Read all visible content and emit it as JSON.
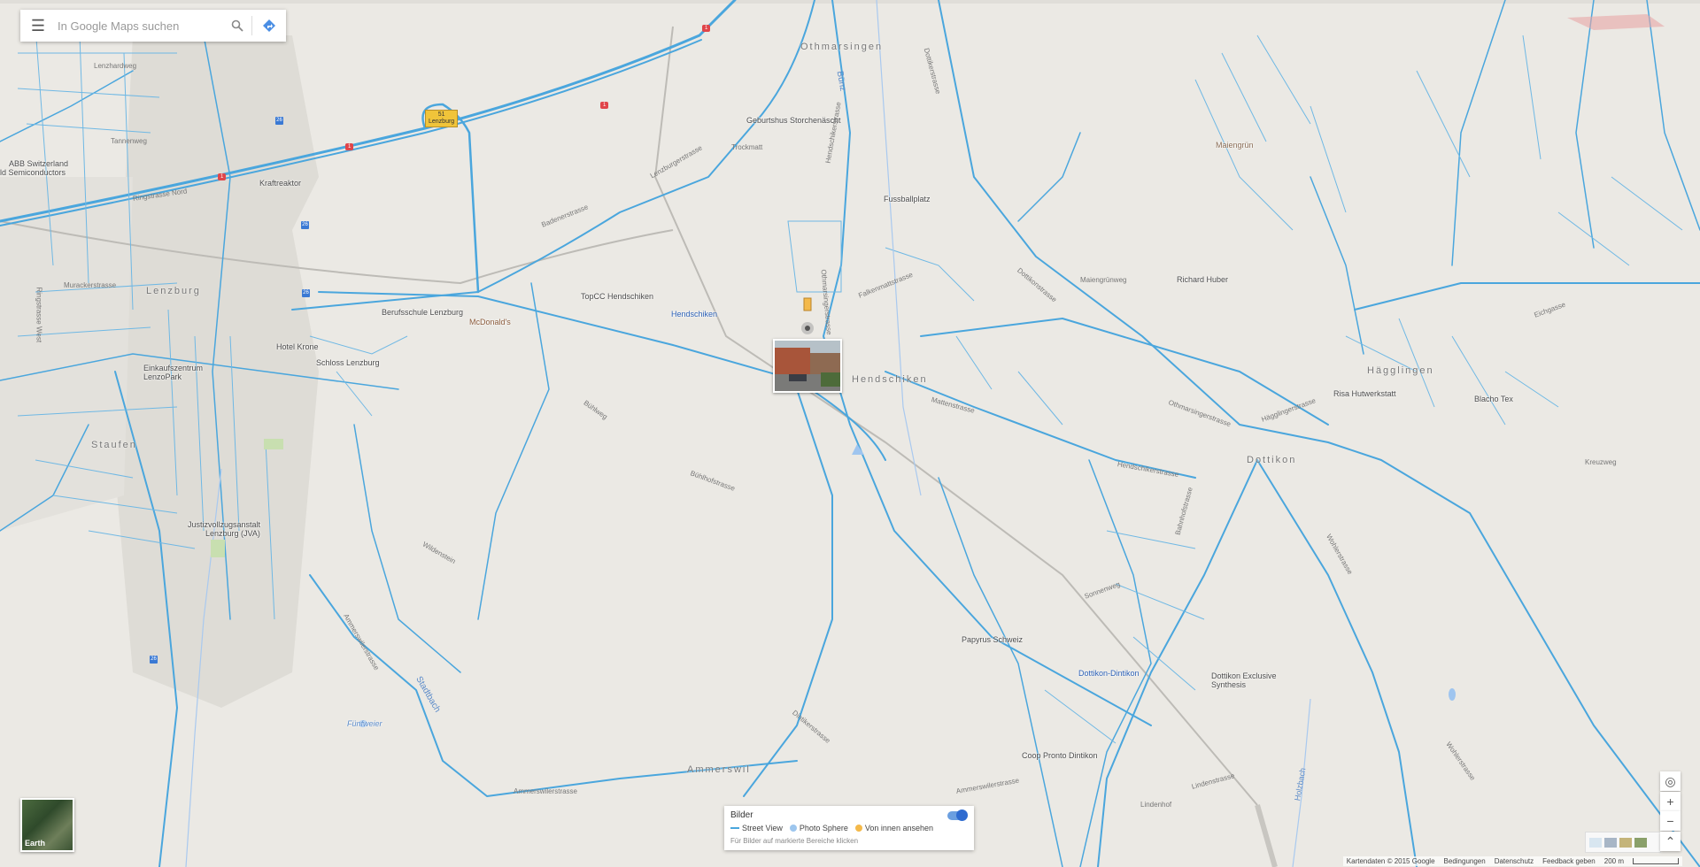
{
  "search": {
    "placeholder": "In Google Maps suchen"
  },
  "icons": {
    "menu": "hamburger-icon",
    "search": "search-icon",
    "directions": "directions-icon"
  },
  "colors": {
    "road": "#4aa6dd",
    "land": "#ebe9e4",
    "accent": "#2e6bd0"
  },
  "towns": [
    {
      "name": "Othmarsingen"
    },
    {
      "name": "Lenzburg"
    },
    {
      "name": "Hendschiken"
    },
    {
      "name": "Hägglingen"
    },
    {
      "name": "Staufen"
    },
    {
      "name": "Dottikon"
    },
    {
      "name": "Ammerswil"
    }
  ],
  "places": [
    "ABB Switzerland",
    "ld Semiconductors",
    "Kraftreaktor",
    "TopCC Hendschiken",
    "Hendschiken",
    "Geburtshus Storchenäscht",
    "Fussballplatz",
    "Maiengrün",
    "Richard Huber",
    "Berufsschule Lenzburg",
    "McDonald's",
    "Hotel Krone",
    "Schloss Lenzburg",
    "Einkaufszentrum",
    "LenzoPark",
    "Justizvollzugsanstalt",
    "Lenzburg (JVA)",
    "Risa Hutwerkstatt",
    "Blacho Tex",
    "Papyrus Schweiz",
    "Dottikon-Dintikon",
    "Dottikon Exclusive",
    "Synthesis",
    "Coop Pronto Dintikon",
    "Fünfweier"
  ],
  "streets": [
    "Lenzhardweg",
    "Tannenweg",
    "Ringstrasse Nord",
    "Murackerstrasse",
    "Ringstrasse West",
    "Badenerstrasse",
    "Lenzburgerstrasse",
    "Trockmatt",
    "Dottikerstrasse",
    "Hendschikerstrasse",
    "Othmarsingerstrasse",
    "Falkenmattstrasse",
    "Maiengrünweg",
    "Dottikonstrasse",
    "Hendschikerstrasse",
    "Ammerswilerstrasse",
    "Wohlerstrasse",
    "Hägglingerstrasse",
    "Eichgasse",
    "Bühlweg",
    "Bühlhofstrasse",
    "Mattenstrasse",
    "Othmarsingerstrasse",
    "Bahnhofstrasse",
    "Sonnenweg",
    "Lindenhof",
    "Lindenstrasse",
    "Wohlerstrasse",
    "Kreuzweg",
    "Dintikerstrasse",
    "Ammerswilerstrasse",
    "Wildenstein",
    "Ammerswilerstrasse"
  ],
  "water": [
    "Bünz",
    "Stadtbach",
    "Holzbach"
  ],
  "road_numbers": [
    "1",
    "1",
    "1",
    "1",
    "26",
    "26",
    "26",
    "26"
  ],
  "highway_exit": {
    "number": "51",
    "name": "Lenzburg"
  },
  "earth": {
    "label": "Earth"
  },
  "imagery": {
    "title": "Bilder",
    "legend": [
      "Street View",
      "Photo Sphere",
      "Von innen ansehen"
    ],
    "hint": "Für Bilder auf markierte Bereiche klicken"
  },
  "footer": {
    "copyright": "Kartendaten © 2015 Google",
    "terms": "Bedingungen",
    "privacy": "Datenschutz",
    "feedback": "Feedback geben",
    "scale": "200 m"
  }
}
